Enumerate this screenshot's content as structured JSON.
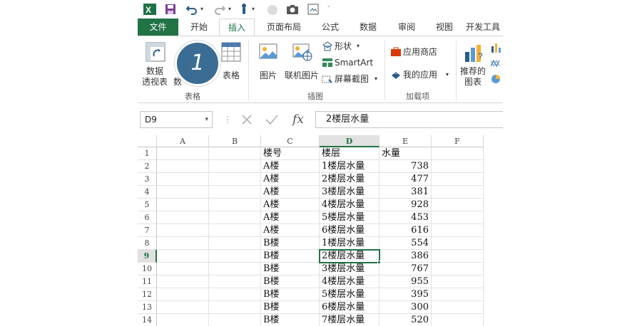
{
  "colors": {
    "accent": "#217346",
    "badge": "#3b6d94",
    "excel_green": "#1e7145"
  },
  "qat": {
    "icons": [
      "excel-logo-icon",
      "save-icon",
      "undo-icon",
      "redo-icon",
      "touch-mode-icon",
      "circle-icon",
      "camera-icon",
      "screenshot-icon",
      "customize-icon"
    ]
  },
  "tabs": [
    {
      "label": "文件"
    },
    {
      "label": "开始"
    },
    {
      "label": "插入"
    },
    {
      "label": "页面布局"
    },
    {
      "label": "公式"
    },
    {
      "label": "数据"
    },
    {
      "label": "审阅"
    },
    {
      "label": "视图"
    },
    {
      "label": "开发工具"
    }
  ],
  "ribbon": {
    "pivot_label_1": "数据",
    "pivot_label_2": "透视表",
    "recommended_pivot_partial": "数",
    "table_label": "表格",
    "group_tables": "表格",
    "pictures_label": "图片",
    "online_pictures_label": "联机图片",
    "shapes_label": "形状",
    "smartart_label": "SmartArt",
    "screenshot_label": "屏幕截图",
    "group_illustrations": "插图",
    "store_label": "应用商店",
    "myapps_label": "我的应用",
    "group_addins": "加载项",
    "rec_charts_label_1": "推荐的",
    "rec_charts_label_2": "图表"
  },
  "badge": {
    "text": "1"
  },
  "formula_bar": {
    "name_box": "D9",
    "formula": "2楼层水量",
    "fx": "fx"
  },
  "columns": [
    "A",
    "B",
    "C",
    "D",
    "E",
    "F"
  ],
  "selected_column": "D",
  "selected_row": "9",
  "rows": [
    {
      "num": "1",
      "C": "楼号",
      "D": "楼层",
      "E": "水量"
    },
    {
      "num": "2",
      "C": "A楼",
      "D": "1楼层水量",
      "E": "738"
    },
    {
      "num": "3",
      "C": "A楼",
      "D": "2楼层水量",
      "E": "477"
    },
    {
      "num": "4",
      "C": "A楼",
      "D": "3楼层水量",
      "E": "381"
    },
    {
      "num": "5",
      "C": "A楼",
      "D": "4楼层水量",
      "E": "928"
    },
    {
      "num": "6",
      "C": "A楼",
      "D": "5楼层水量",
      "E": "453"
    },
    {
      "num": "7",
      "C": "A楼",
      "D": "6楼层水量",
      "E": "616"
    },
    {
      "num": "8",
      "C": "B楼",
      "D": "1楼层水量",
      "E": "554"
    },
    {
      "num": "9",
      "C": "B楼",
      "D": "2楼层水量",
      "E": "386"
    },
    {
      "num": "10",
      "C": "B楼",
      "D": "3楼层水量",
      "E": "767"
    },
    {
      "num": "11",
      "C": "B楼",
      "D": "4楼层水量",
      "E": "955"
    },
    {
      "num": "12",
      "C": "B楼",
      "D": "5楼层水量",
      "E": "395"
    },
    {
      "num": "13",
      "C": "B楼",
      "D": "6楼层水量",
      "E": "300"
    },
    {
      "num": "14",
      "C": "B楼",
      "D": "7楼层水量",
      "E": "520"
    }
  ]
}
